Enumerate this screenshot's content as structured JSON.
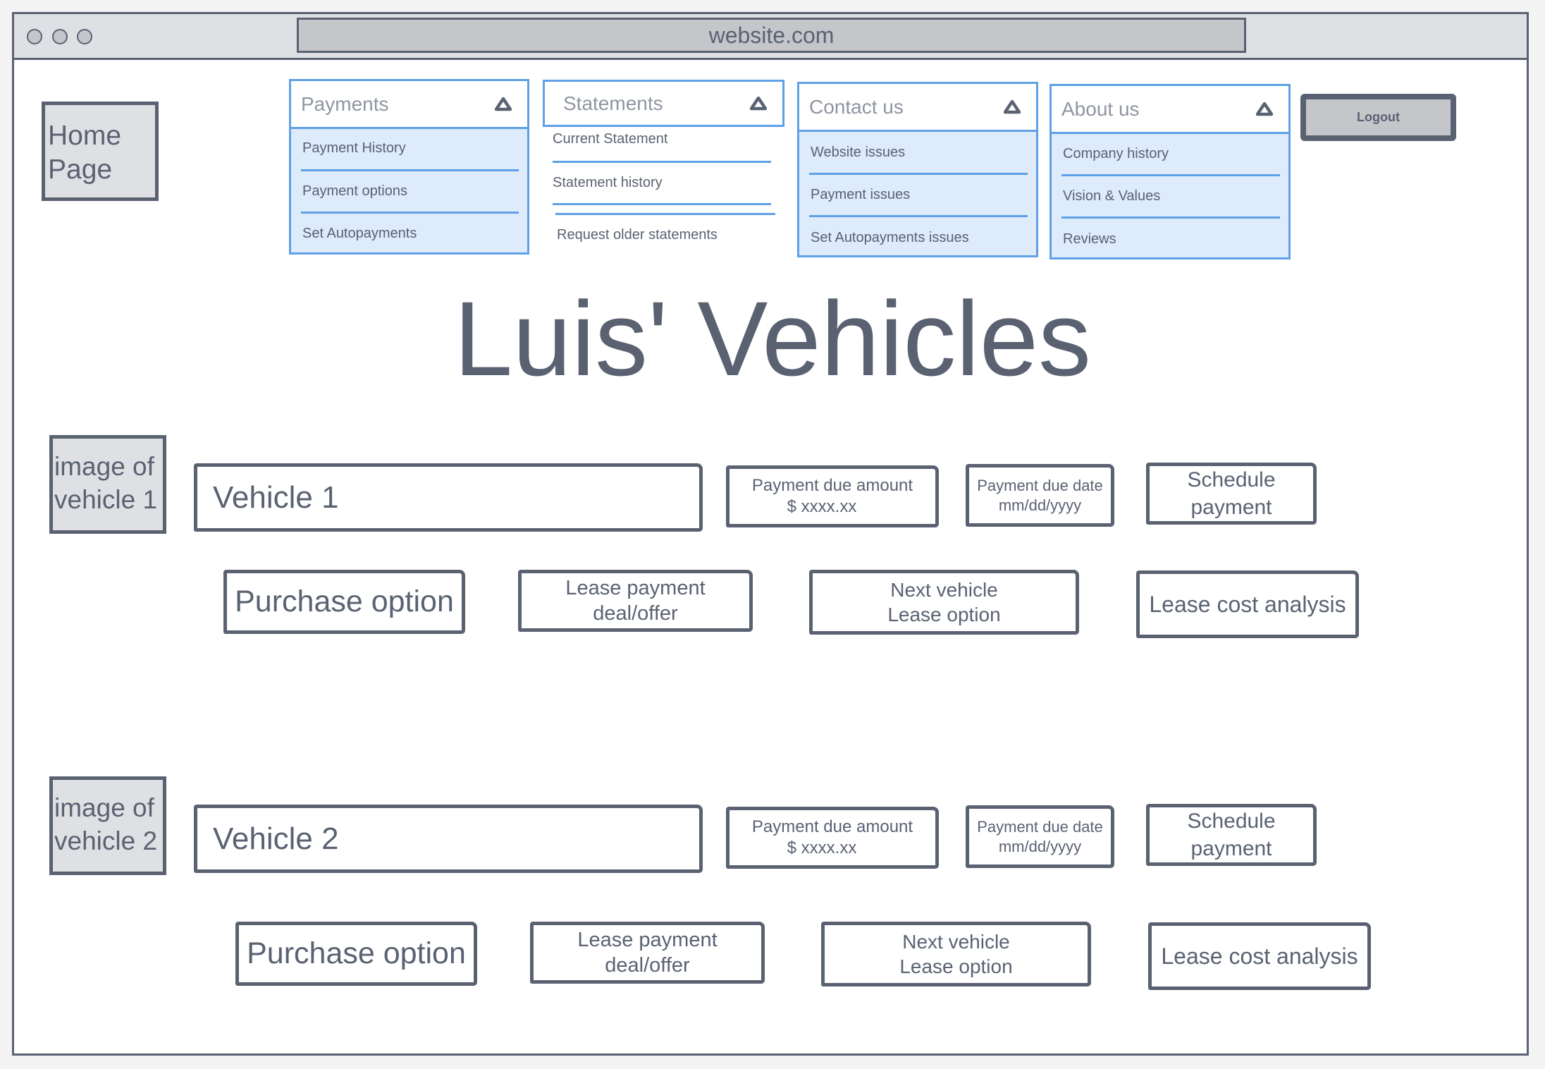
{
  "browser": {
    "url": "website.com",
    "window_controls": [
      "circle",
      "circle",
      "circle"
    ]
  },
  "nav": {
    "home_label_line1": "Home",
    "home_label_line2": "Page",
    "menus": [
      {
        "label": "Payments",
        "icon": "caret-up-icon",
        "items": [
          "Payment History",
          "Payment options",
          "Set Autopayments"
        ]
      },
      {
        "label": "Statements",
        "icon": "caret-up-icon",
        "items": [
          "Current Statement",
          "Statement history",
          "Request older statements"
        ]
      },
      {
        "label": "Contact us",
        "icon": "caret-up-icon",
        "items": [
          "Website issues",
          "Payment issues",
          "Set Autopayments issues"
        ]
      },
      {
        "label": "About us",
        "icon": "caret-up-icon",
        "items": [
          "Company history",
          "Vision & Values",
          "Reviews"
        ]
      }
    ],
    "logout_label": "Logout"
  },
  "page_title": "Luis' Vehicles",
  "vehicles": [
    {
      "image_line1": "image of",
      "image_line2": "vehicle 1",
      "name": "Vehicle 1",
      "payment_due_amount_label": "Payment due amount",
      "payment_due_amount_value": "$ xxxx.xx",
      "payment_due_date_label": "Payment due date",
      "payment_due_date_value": "mm/dd/yyyy",
      "schedule_line1": "Schedule",
      "schedule_line2": "payment",
      "purchase_option": "Purchase option",
      "lease_payment_line1": "Lease payment",
      "lease_payment_line2": "deal/offer",
      "next_vehicle_line1": "Next vehicle",
      "next_vehicle_line2": "Lease option",
      "lease_cost_analysis": "Lease cost analysis"
    },
    {
      "image_line1": "image of",
      "image_line2": "vehicle 2",
      "name": "Vehicle 2",
      "payment_due_amount_label": "Payment due amount",
      "payment_due_amount_value": "$ xxxx.xx",
      "payment_due_date_label": "Payment due date",
      "payment_due_date_value": "mm/dd/yyyy",
      "schedule_line1": "Schedule",
      "schedule_line2": "payment",
      "purchase_option": "Purchase option",
      "lease_payment_line1": "Lease payment",
      "lease_payment_line2": "deal/offer",
      "next_vehicle_line1": "Next vehicle",
      "next_vehicle_line2": "Lease option",
      "lease_cost_analysis": "Lease cost analysis"
    }
  ],
  "colors": {
    "ink": "#5a6272",
    "accent_blue": "#5fa0e6",
    "menu_fill": "#ddebfa",
    "placeholder_gray": "#dfe0e3"
  }
}
